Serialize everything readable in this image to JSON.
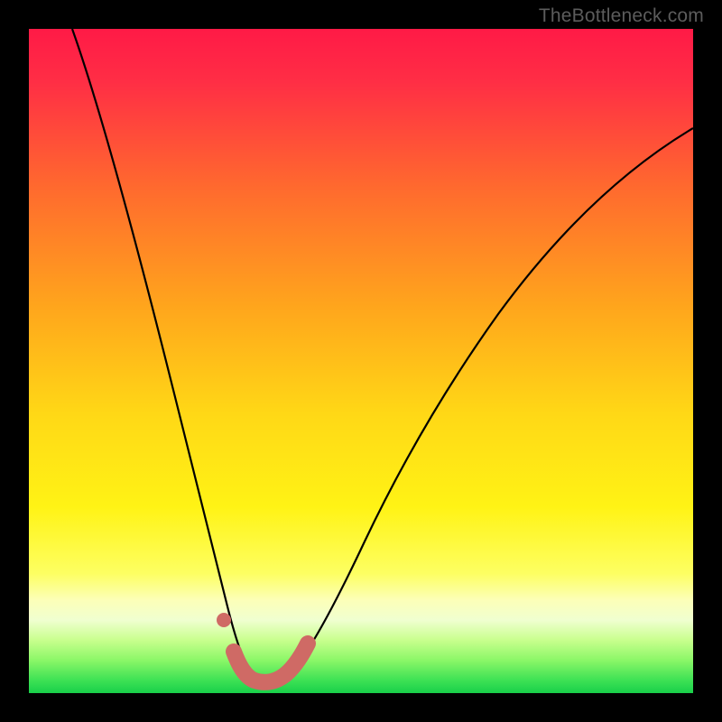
{
  "watermark": "TheBottleneck.com",
  "colors": {
    "frame": "#000000",
    "gradient_top": "#ff1a46",
    "gradient_mid1": "#ff8a22",
    "gradient_mid2": "#ffe916",
    "gradient_low1": "#fffca0",
    "gradient_low2": "#bfff60",
    "gradient_bottom": "#1cd94f",
    "curve": "#000000",
    "marker": "#cf6a65"
  },
  "chart_data": {
    "type": "line",
    "title": "",
    "xlabel": "",
    "ylabel": "",
    "xlim": [
      0,
      100
    ],
    "ylim": [
      0,
      100
    ],
    "series": [
      {
        "name": "bottleneck-curve",
        "x": [
          5,
          8,
          12,
          16,
          20,
          24,
          27,
          29,
          31,
          33,
          35,
          38,
          42,
          48,
          56,
          64,
          72,
          80,
          88,
          96,
          100
        ],
        "y": [
          100,
          85,
          68,
          52,
          38,
          25,
          15,
          8,
          3,
          1,
          1,
          3,
          8,
          17,
          30,
          42,
          52,
          60,
          67,
          73,
          76
        ]
      }
    ],
    "markers": [
      {
        "name": "dot-left",
        "x": 28.5,
        "y": 11
      },
      {
        "name": "thick-trough-left-end",
        "x": 30,
        "y": 4
      },
      {
        "name": "thick-trough-right-end",
        "x": 41,
        "y": 4
      }
    ],
    "annotations": []
  }
}
